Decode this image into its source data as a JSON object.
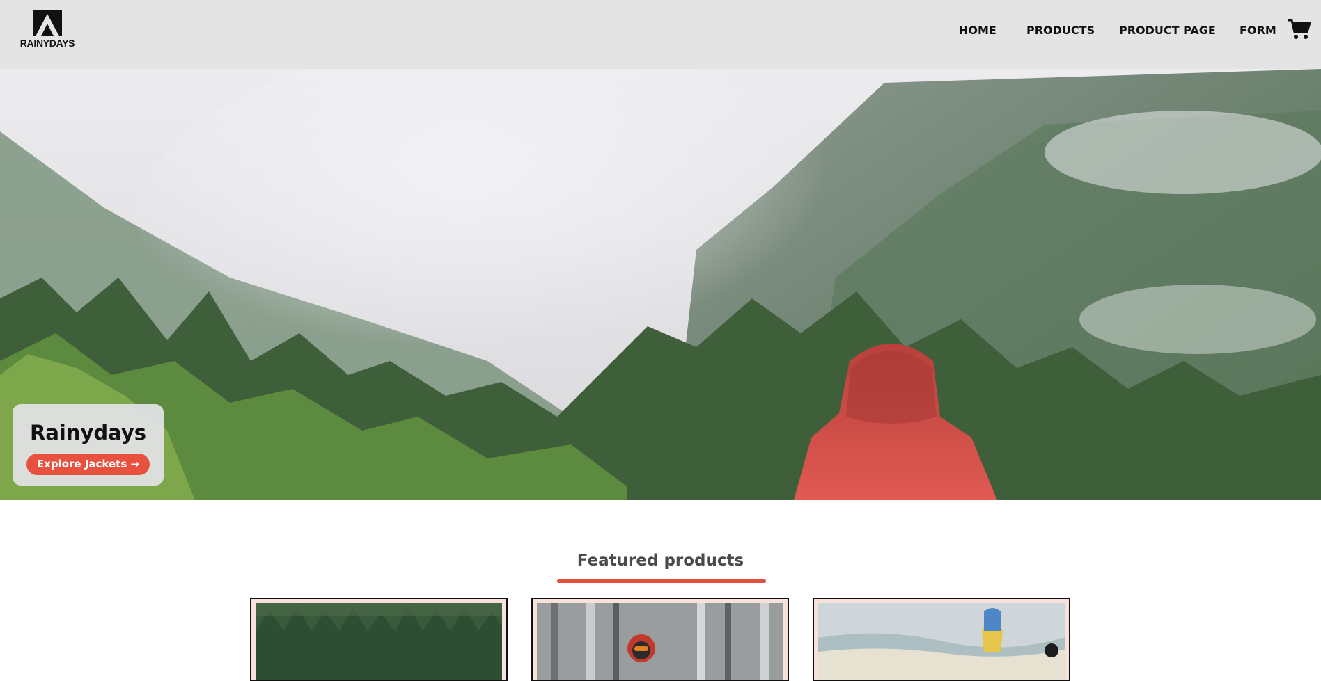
{
  "header": {
    "logo_text": "RAINYDAYS",
    "nav": [
      {
        "label": "HOME"
      },
      {
        "label": "PRODUCTS"
      },
      {
        "label": "PRODUCT PAGE"
      },
      {
        "label": "FORM"
      }
    ],
    "cart_icon": "cart-icon"
  },
  "hero": {
    "title": "Rainydays",
    "button_label": "Explore Jackets →"
  },
  "featured": {
    "title": "Featured products",
    "cards": [
      {
        "image": "forest-product-image"
      },
      {
        "image": "snow-forest-person-image"
      },
      {
        "image": "beach-surf-person-image"
      }
    ]
  },
  "colors": {
    "header_bg": "#e4e4e4",
    "accent": "#e9513f",
    "hero_card_bg": "#e0e0e2",
    "title_text": "#4a4a4a"
  }
}
